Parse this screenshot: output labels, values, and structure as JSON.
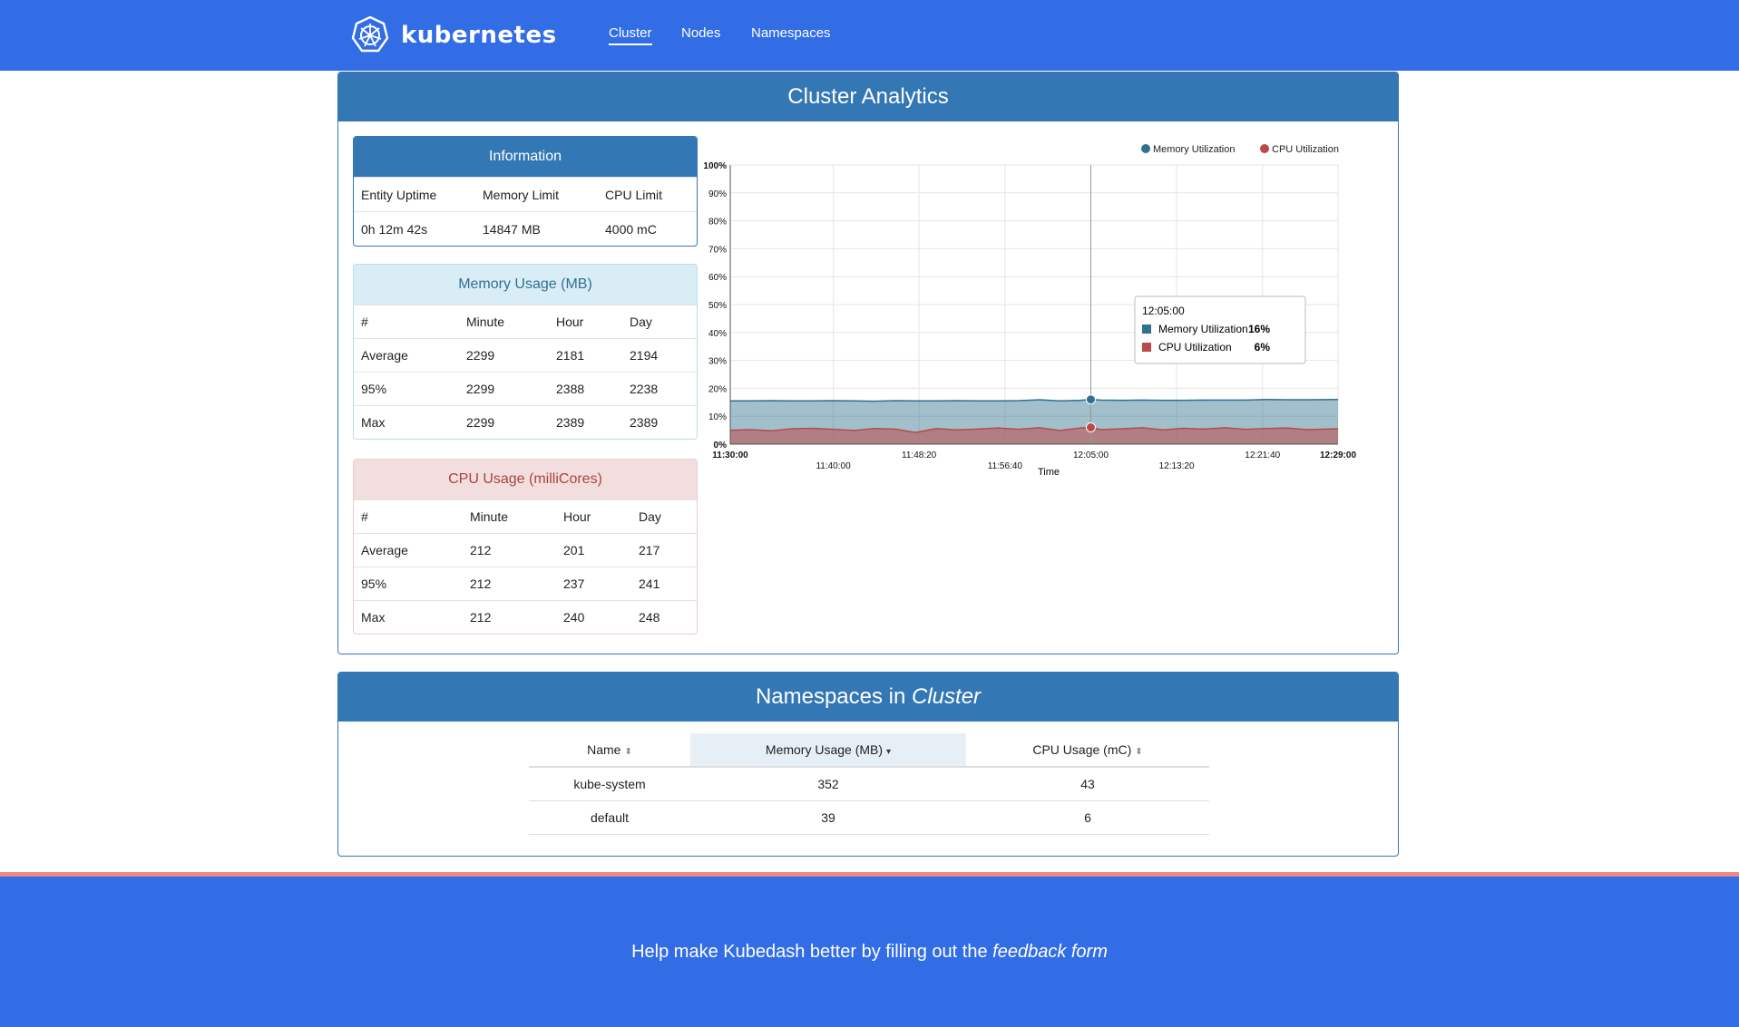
{
  "brand": {
    "name": "kubernetes"
  },
  "nav": {
    "items": [
      {
        "label": "Cluster",
        "active": true
      },
      {
        "label": "Nodes",
        "active": false
      },
      {
        "label": "Namespaces",
        "active": false
      }
    ]
  },
  "analytics": {
    "title": "Cluster Analytics",
    "information": {
      "title": "Information",
      "headers": [
        "Entity Uptime",
        "Memory Limit",
        "CPU Limit"
      ],
      "values": [
        "0h 12m 42s",
        "14847 MB",
        "4000 mC"
      ]
    },
    "memory": {
      "title": "Memory Usage (MB)",
      "headers": [
        "#",
        "Minute",
        "Hour",
        "Day"
      ],
      "rows": [
        [
          "Average",
          "2299",
          "2181",
          "2194"
        ],
        [
          "95%",
          "2299",
          "2388",
          "2238"
        ],
        [
          "Max",
          "2299",
          "2389",
          "2389"
        ]
      ]
    },
    "cpu": {
      "title": "CPU Usage (milliCores)",
      "headers": [
        "#",
        "Minute",
        "Hour",
        "Day"
      ],
      "rows": [
        [
          "Average",
          "212",
          "201",
          "217"
        ],
        [
          "95%",
          "212",
          "237",
          "241"
        ],
        [
          "Max",
          "212",
          "240",
          "248"
        ]
      ]
    }
  },
  "chart_data": {
    "type": "area",
    "xlabel": "Time",
    "ylabel": "",
    "ylim": [
      0,
      100
    ],
    "y_ticks": [
      "0%",
      "10%",
      "20%",
      "30%",
      "40%",
      "50%",
      "60%",
      "70%",
      "80%",
      "90%",
      "100%"
    ],
    "x_ticks": [
      "11:30:00",
      "11:40:00",
      "11:48:20",
      "11:56:40",
      "12:05:00",
      "12:13:20",
      "12:21:40",
      "12:29:00"
    ],
    "legend_position": "top-right",
    "grid": true,
    "x_minutes": [
      0,
      2,
      4,
      6,
      8,
      10,
      12,
      14,
      16,
      18,
      20,
      22,
      24,
      26,
      28,
      30,
      32,
      34,
      35,
      36,
      38,
      40,
      42,
      44,
      46,
      48,
      50,
      52,
      54,
      56,
      59
    ],
    "series": [
      {
        "name": "Memory Utilization",
        "color": "#31708f",
        "values": [
          15.5,
          15.5,
          15.6,
          15.5,
          15.5,
          15.6,
          15.5,
          15.4,
          15.6,
          15.5,
          15.5,
          15.6,
          15.5,
          15.5,
          15.6,
          15.9,
          15.5,
          15.7,
          16,
          15.8,
          15.7,
          15.8,
          15.7,
          15.7,
          15.8,
          15.8,
          15.8,
          16,
          15.9,
          15.9,
          16
        ]
      },
      {
        "name": "CPU Utilization",
        "color": "#b94a48",
        "values": [
          5,
          5.2,
          4.8,
          5.5,
          5.7,
          5.3,
          4.9,
          5.6,
          5.4,
          4.2,
          5.6,
          5.1,
          5.4,
          5.8,
          5.3,
          5.9,
          4.9,
          5.8,
          6,
          5.2,
          5.5,
          5.9,
          5.1,
          5.7,
          5.4,
          5.9,
          5.3,
          5.6,
          5.8,
          5.2,
          5.5
        ]
      }
    ],
    "tooltip": {
      "time": "12:05:00",
      "memory_label": "Memory Utilization",
      "memory_value": "16%",
      "cpu_label": "CPU Utilization",
      "cpu_value": "6%",
      "hover_minute": 35
    }
  },
  "namespaces": {
    "title_prefix": "Namespaces in ",
    "title_emph": "Cluster",
    "headers": [
      "Name",
      "Memory Usage (MB)",
      "CPU Usage (mC)"
    ],
    "rows": [
      [
        "kube-system",
        "352",
        "43"
      ],
      [
        "default",
        "39",
        "6"
      ]
    ]
  },
  "footer": {
    "text": "Help make Kubedash better by filling out the ",
    "link": "feedback form"
  },
  "colors": {
    "primary": "#326de6",
    "panel_blue": "#3377b5",
    "memory": "#31708f",
    "cpu": "#b94a48",
    "footer_strip": "#f08a80"
  }
}
